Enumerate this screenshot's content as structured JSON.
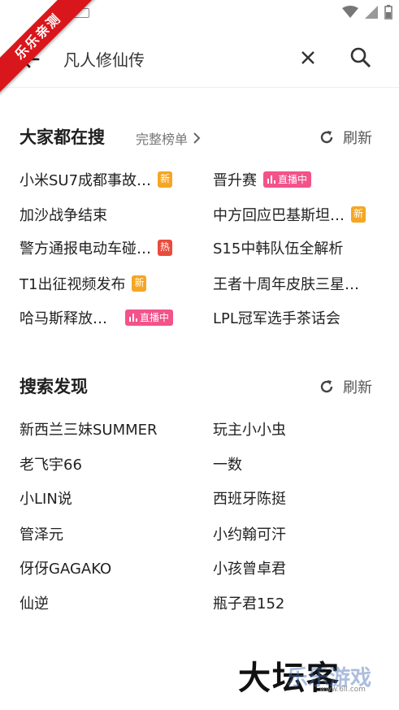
{
  "watermark_corner": "乐乐亲测",
  "search": {
    "query": "凡人修仙传"
  },
  "hot_section": {
    "title": "大家都在搜",
    "full_list_label": "完整榜单",
    "refresh_label": "刷新",
    "items": [
      {
        "text": "小米SU7成都事故…",
        "badge": "新"
      },
      {
        "text": "晋升赛",
        "badge": "直播中"
      },
      {
        "text": "加沙战争结束",
        "badge": ""
      },
      {
        "text": "中方回应巴基斯坦…",
        "badge": "新"
      },
      {
        "text": "警方通报电动车碰…",
        "badge": "热"
      },
      {
        "text": "S15中韩队伍全解析",
        "badge": ""
      },
      {
        "text": "T1出征视频发布",
        "badge": "新"
      },
      {
        "text": "王者十周年皮肤三星…",
        "badge": ""
      },
      {
        "text": "哈马斯释放…",
        "badge": "直播中"
      },
      {
        "text": "LPL冠军选手茶话会",
        "badge": ""
      }
    ]
  },
  "discover_section": {
    "title": "搜索发现",
    "refresh_label": "刷新",
    "items": [
      {
        "text": "新西兰三妹SUMMER"
      },
      {
        "text": "玩主小小虫"
      },
      {
        "text": "老飞宇66"
      },
      {
        "text": "一数"
      },
      {
        "text": "小LIN说"
      },
      {
        "text": "西班牙陈挺"
      },
      {
        "text": "管泽元"
      },
      {
        "text": "小约翰可汗"
      },
      {
        "text": "伢伢GAGAKO"
      },
      {
        "text": "小孩曾卓君"
      },
      {
        "text": "仙逆"
      },
      {
        "text": "瓶子君152"
      }
    ]
  },
  "watermark_bottom": {
    "text": "大坛客",
    "text2": "乐乐游戏",
    "url": "www.6ll.com"
  },
  "colors": {
    "badge_new": "#f5a623",
    "badge_hot": "#e94b3c",
    "badge_live": "#f3528a",
    "ribbon": "#d9161c"
  }
}
